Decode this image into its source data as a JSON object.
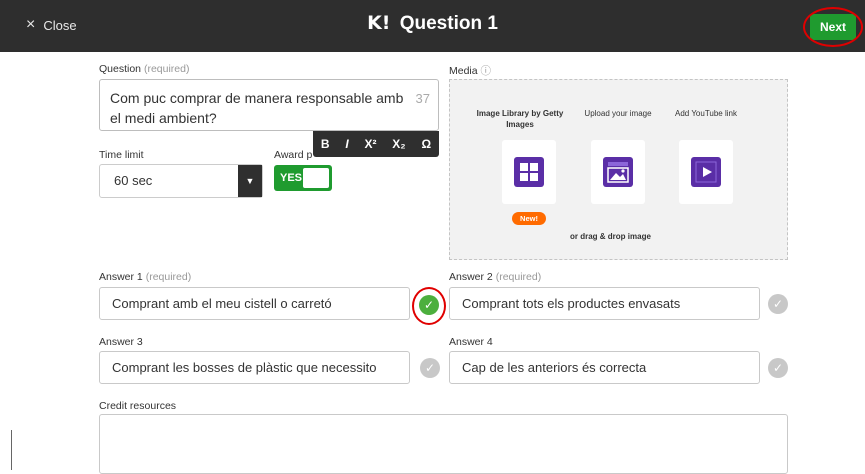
{
  "header": {
    "close_label": "Close",
    "close_icon": "×",
    "logo": "K!",
    "title": "Question 1",
    "next_label": "Next"
  },
  "question": {
    "label": "Question",
    "required": "(required)",
    "text": "Com puc comprar de manera responsable amb el medi ambient?",
    "char_count": "37"
  },
  "format_toolbar": {
    "bold": "B",
    "italic": "I",
    "superscript": "X²",
    "subscript": "X₂",
    "special": "Ω"
  },
  "time_limit": {
    "label": "Time limit",
    "value": "60 sec"
  },
  "award_points": {
    "label": "Award p",
    "toggle": "YES"
  },
  "media": {
    "label": "Media",
    "options": [
      {
        "label": "Image Library by Getty Images",
        "icon": "image-library-icon"
      },
      {
        "label": "Upload your image",
        "icon": "upload-image-icon"
      },
      {
        "label": "Add YouTube link",
        "icon": "youtube-icon"
      }
    ],
    "new_badge": "New!",
    "drag_text": "or drag & drop image"
  },
  "answers": [
    {
      "label": "Answer 1",
      "required": "(required)",
      "value": "Comprant amb el meu cistell o carretó",
      "correct": true
    },
    {
      "label": "Answer 2",
      "required": "(required)",
      "value": "Comprant tots els productes envasats",
      "correct": false
    },
    {
      "label": "Answer 3",
      "required": "",
      "value": "Comprant les bosses de plàstic que necessito",
      "correct": false
    },
    {
      "label": "Answer 4",
      "required": "",
      "value": "Cap de les anteriors és correcta",
      "correct": false
    }
  ],
  "credit": {
    "label": "Credit resources"
  },
  "colors": {
    "accent_green": "#1f9b2f",
    "purple": "#5a2ea6",
    "header": "#2e2e2e",
    "annotation_red": "#e00000"
  }
}
